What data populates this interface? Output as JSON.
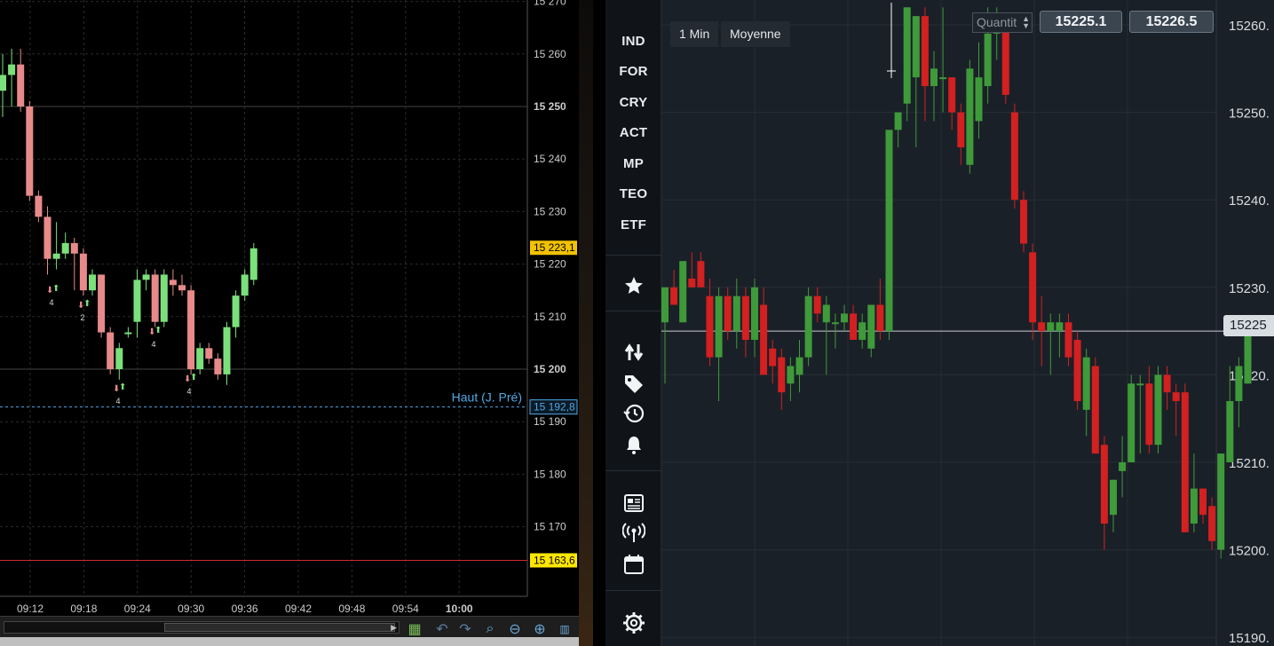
{
  "left_chart": {
    "y_ticks": [
      "15 270",
      "15 260",
      "15 250",
      "15 240",
      "15 230",
      "15 220",
      "15 210",
      "15 200",
      "15 190",
      "15 180",
      "15 170"
    ],
    "bold_ticks": [
      "15 250",
      "15 200"
    ],
    "x_ticks": [
      "09:12",
      "09:18",
      "09:24",
      "09:30",
      "09:36",
      "09:42",
      "09:48",
      "09:54",
      "10:00"
    ],
    "bold_x_tick": "10:00",
    "current_price_label": "15 223,1",
    "prev_high": {
      "label": "Haut (J. Pré)",
      "value_label": "15 192,8",
      "value": 15192.8
    },
    "low_line": {
      "value_label": "15 163,6",
      "value": 15163.6
    },
    "signal_numbers": [
      "4",
      "2",
      "4",
      "4",
      "4"
    ],
    "colors": {
      "up": "#7be07b",
      "down": "#e88a8a",
      "grid": "#2a2a2a",
      "axis_text": "#cccccc",
      "prev_high": "#4fa9e6",
      "low_line": "#d22b2b",
      "highlight_bg": "#ffe600"
    },
    "candles": [
      {
        "o": 15253,
        "h": 15260,
        "l": 15248,
        "c": 15256
      },
      {
        "o": 15256,
        "h": 15261,
        "l": 15250,
        "c": 15258
      },
      {
        "o": 15258,
        "h": 15261,
        "l": 15249,
        "c": 15250
      },
      {
        "o": 15250,
        "h": 15251,
        "l": 15232,
        "c": 15233
      },
      {
        "o": 15233,
        "h": 15234,
        "l": 15228,
        "c": 15229
      },
      {
        "o": 15229,
        "h": 15231,
        "l": 15218,
        "c": 15221
      },
      {
        "o": 15221,
        "h": 15228,
        "l": 15219,
        "c": 15222
      },
      {
        "o": 15222,
        "h": 15226,
        "l": 15221,
        "c": 15224
      },
      {
        "o": 15224,
        "h": 15225,
        "l": 15215,
        "c": 15222
      },
      {
        "o": 15222,
        "h": 15223,
        "l": 15214,
        "c": 15215
      },
      {
        "o": 15215,
        "h": 15219,
        "l": 15214,
        "c": 15218
      },
      {
        "o": 15218,
        "h": 15218,
        "l": 15206,
        "c": 15207
      },
      {
        "o": 15207,
        "h": 15208,
        "l": 15199,
        "c": 15200
      },
      {
        "o": 15200,
        "h": 15205,
        "l": 15198,
        "c": 15204
      },
      {
        "o": 15207,
        "h": 15208,
        "l": 15206,
        "c": 15207
      },
      {
        "o": 15209,
        "h": 15219,
        "l": 15206,
        "c": 15217
      },
      {
        "o": 15217,
        "h": 15219,
        "l": 15215,
        "c": 15218
      },
      {
        "o": 15218,
        "h": 15219,
        "l": 15208,
        "c": 15209
      },
      {
        "o": 15209,
        "h": 15219,
        "l": 15208,
        "c": 15218
      },
      {
        "o": 15217,
        "h": 15219,
        "l": 15214,
        "c": 15216
      },
      {
        "o": 15216,
        "h": 15218,
        "l": 15214,
        "c": 15215
      },
      {
        "o": 15215,
        "h": 15216,
        "l": 15199,
        "c": 15200
      },
      {
        "o": 15200,
        "h": 15205,
        "l": 15199,
        "c": 15204
      },
      {
        "o": 15204,
        "h": 15205,
        "l": 15201,
        "c": 15202
      },
      {
        "o": 15202,
        "h": 15203,
        "l": 15198,
        "c": 15199
      },
      {
        "o": 15199,
        "h": 15209,
        "l": 15197,
        "c": 15208
      },
      {
        "o": 15208,
        "h": 15215,
        "l": 15206,
        "c": 15214
      },
      {
        "o": 15214,
        "h": 15219,
        "l": 15213,
        "c": 15218
      },
      {
        "o": 15217,
        "h": 15224,
        "l": 15216,
        "c": 15223
      }
    ]
  },
  "sidebar": {
    "markets": [
      "IND",
      "FOR",
      "CRY",
      "ACT",
      "MP",
      "TEO",
      "ETF"
    ],
    "icons": [
      "star-icon",
      "swap-arrows-icon",
      "tag-icon",
      "history-icon",
      "bell-icon",
      "news-icon",
      "broadcast-icon",
      "calendar-icon",
      "settings-gear-icon"
    ]
  },
  "right_chart": {
    "timeframe": "1 Min",
    "chart_style": "Moyenne",
    "quantity_placeholder": "Quantit",
    "bid_price": "15225.1",
    "ask_price": "15226.5",
    "current_price_label": "15225",
    "y_ticks": [
      "15260.",
      "15250.",
      "15240.",
      "15230.",
      "15220.",
      "15210.",
      "15200.",
      "15190."
    ],
    "colors": {
      "up": "#3f9a3a",
      "down": "#d32020",
      "bg": "#1a2028",
      "grid": "#262d35",
      "axis_text": "#d9dde0"
    },
    "candles": [
      {
        "o": 15226,
        "h": 15228,
        "l": 15219,
        "c": 15230
      },
      {
        "o": 15230,
        "h": 15232,
        "l": 15228,
        "c": 15228
      },
      {
        "o": 15226,
        "h": 15231,
        "l": 15226,
        "c": 15233
      },
      {
        "o": 15231,
        "h": 15234,
        "l": 15230,
        "c": 15230
      },
      {
        "o": 15233,
        "h": 15234,
        "l": 15230,
        "c": 15230
      },
      {
        "o": 15229,
        "h": 15231,
        "l": 15221,
        "c": 15222
      },
      {
        "o": 15222,
        "h": 15230,
        "l": 15217,
        "c": 15229
      },
      {
        "o": 15229,
        "h": 15230,
        "l": 15224,
        "c": 15225
      },
      {
        "o": 15225,
        "h": 15231,
        "l": 15223,
        "c": 15229
      },
      {
        "o": 15229,
        "h": 15230,
        "l": 15222,
        "c": 15224
      },
      {
        "o": 15224,
        "h": 15231,
        "l": 15222,
        "c": 15230
      },
      {
        "o": 15228,
        "h": 15230,
        "l": 15222,
        "c": 15220
      },
      {
        "o": 15223,
        "h": 15224,
        "l": 15219,
        "c": 15221
      },
      {
        "o": 15222,
        "h": 15223,
        "l": 15216,
        "c": 15218
      },
      {
        "o": 15219,
        "h": 15222,
        "l": 15217,
        "c": 15221
      },
      {
        "o": 15220,
        "h": 15224,
        "l": 15218,
        "c": 15222
      },
      {
        "o": 15222,
        "h": 15230,
        "l": 15221,
        "c": 15229
      },
      {
        "o": 15229,
        "h": 15230,
        "l": 15226,
        "c": 15227
      },
      {
        "o": 15226,
        "h": 15229,
        "l": 15220,
        "c": 15228
      },
      {
        "o": 15226,
        "h": 15227,
        "l": 15223,
        "c": 15226
      },
      {
        "o": 15226,
        "h": 15228,
        "l": 15225,
        "c": 15227
      },
      {
        "o": 15227,
        "h": 15228,
        "l": 15224,
        "c": 15224
      },
      {
        "o": 15224,
        "h": 15227,
        "l": 15223,
        "c": 15226
      },
      {
        "o": 15223,
        "h": 15226,
        "l": 15222,
        "c": 15228
      },
      {
        "o": 15228,
        "h": 15231,
        "l": 15224,
        "c": 15225
      },
      {
        "o": 15225,
        "h": 15227,
        "l": 15224,
        "c": 15248
      },
      {
        "o": 15248,
        "h": 15250,
        "l": 15246,
        "c": 15250
      },
      {
        "o": 15251,
        "h": 15262,
        "l": 15249,
        "c": 15262
      },
      {
        "o": 15254,
        "h": 15261,
        "l": 15246,
        "c": 15261
      },
      {
        "o": 15261,
        "h": 15262,
        "l": 15249,
        "c": 15253
      },
      {
        "o": 15253,
        "h": 15257,
        "l": 15249,
        "c": 15255
      },
      {
        "o": 15254,
        "h": 15262,
        "l": 15250,
        "c": 15254
      },
      {
        "o": 15254,
        "h": 15254,
        "l": 15248,
        "c": 15250
      },
      {
        "o": 15250,
        "h": 15251,
        "l": 15244,
        "c": 15246
      },
      {
        "o": 15244,
        "h": 15256,
        "l": 15243,
        "c": 15255
      },
      {
        "o": 15249,
        "h": 15258,
        "l": 15247,
        "c": 15254
      },
      {
        "o": 15253,
        "h": 15262,
        "l": 15251,
        "c": 15259
      },
      {
        "o": 15259,
        "h": 15262,
        "l": 15256,
        "c": 15261
      },
      {
        "o": 15260,
        "h": 15261,
        "l": 15251,
        "c": 15252
      },
      {
        "o": 15250,
        "h": 15251,
        "l": 15239,
        "c": 15240
      },
      {
        "o": 15240,
        "h": 15241,
        "l": 15234,
        "c": 15235
      },
      {
        "o": 15234,
        "h": 15235,
        "l": 15224,
        "c": 15226
      },
      {
        "o": 15226,
        "h": 15229,
        "l": 15221,
        "c": 15225
      },
      {
        "o": 15225,
        "h": 15227,
        "l": 15220,
        "c": 15226
      },
      {
        "o": 15225,
        "h": 15227,
        "l": 15222,
        "c": 15226
      },
      {
        "o": 15226,
        "h": 15227,
        "l": 15221,
        "c": 15222
      },
      {
        "o": 15224,
        "h": 15225,
        "l": 15216,
        "c": 15217
      },
      {
        "o": 15216,
        "h": 15223,
        "l": 15213,
        "c": 15222
      },
      {
        "o": 15221,
        "h": 15222,
        "l": 15211,
        "c": 15211
      },
      {
        "o": 15212,
        "h": 15213,
        "l": 15200,
        "c": 15203
      },
      {
        "o": 15204,
        "h": 15208,
        "l": 15202,
        "c": 15208
      },
      {
        "o": 15209,
        "h": 15213,
        "l": 15206,
        "c": 15210
      },
      {
        "o": 15210,
        "h": 15220,
        "l": 15210,
        "c": 15219
      },
      {
        "o": 15219,
        "h": 15220,
        "l": 15211,
        "c": 15219
      },
      {
        "o": 15219,
        "h": 15221,
        "l": 15211,
        "c": 15212
      },
      {
        "o": 15212,
        "h": 15221,
        "l": 15211,
        "c": 15220
      },
      {
        "o": 15220,
        "h": 15221,
        "l": 15216,
        "c": 15218
      },
      {
        "o": 15218,
        "h": 15219,
        "l": 15213,
        "c": 15217
      },
      {
        "o": 15218,
        "h": 15219,
        "l": 15211,
        "c": 15202
      },
      {
        "o": 15203,
        "h": 15211,
        "l": 15202,
        "c": 15207
      },
      {
        "o": 15207,
        "h": 15207,
        "l": 15203,
        "c": 15204
      },
      {
        "o": 15205,
        "h": 15206,
        "l": 15200,
        "c": 15201
      },
      {
        "o": 15200,
        "h": 15211,
        "l": 15199,
        "c": 15211
      },
      {
        "o": 15210,
        "h": 15221,
        "l": 15210,
        "c": 15217
      },
      {
        "o": 15217,
        "h": 15222,
        "l": 15214,
        "c": 15221
      },
      {
        "o": 15219,
        "h": 15226,
        "l": 15219,
        "c": 15225
      }
    ]
  }
}
